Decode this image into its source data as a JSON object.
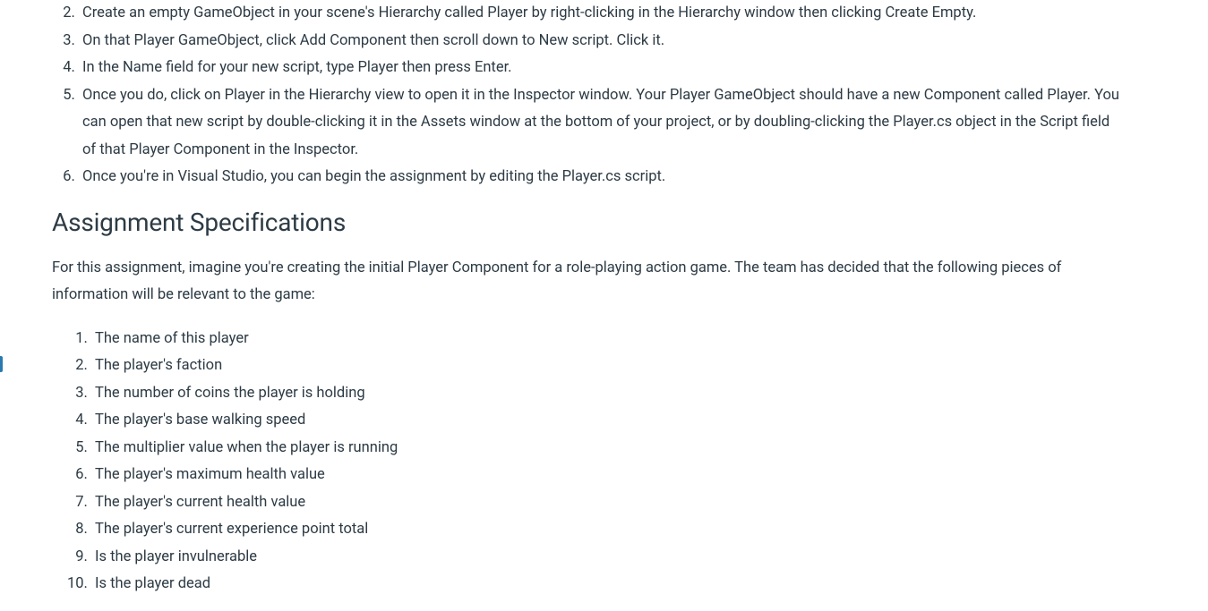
{
  "setup_steps": {
    "start": 2,
    "items": [
      "Create an empty GameObject in your scene's Hierarchy called Player by right-clicking in the Hierarchy window then clicking Create Empty.",
      "On that Player GameObject, click Add Component then scroll down to New script. Click it.",
      "In the Name field for your new script, type Player then press Enter.",
      "Once you do, click on Player in the Hierarchy view to open it in the Inspector window. Your Player GameObject should have a new Component called Player. You can open that new script by double-clicking it in the Assets window at the bottom of your project, or by doubling-clicking the Player.cs object in the Script field of that Player Component in the Inspector.",
      "Once you're in Visual Studio, you can begin the assignment by editing the Player.cs script."
    ]
  },
  "section_title": "Assignment Specifications",
  "intro_text": "For this assignment, imagine you're creating the initial Player Component for a role-playing action game. The team has decided that the following pieces of information will be relevant to the game:",
  "spec_items": [
    "The name of this player",
    "The player's faction",
    "The number of coins the player is holding",
    "The player's base walking speed",
    "The multiplier value when the player is running",
    "The player's maximum health value",
    "The player's current health value",
    "The player's current experience point total",
    "Is the player invulnerable",
    "Is the player dead"
  ]
}
